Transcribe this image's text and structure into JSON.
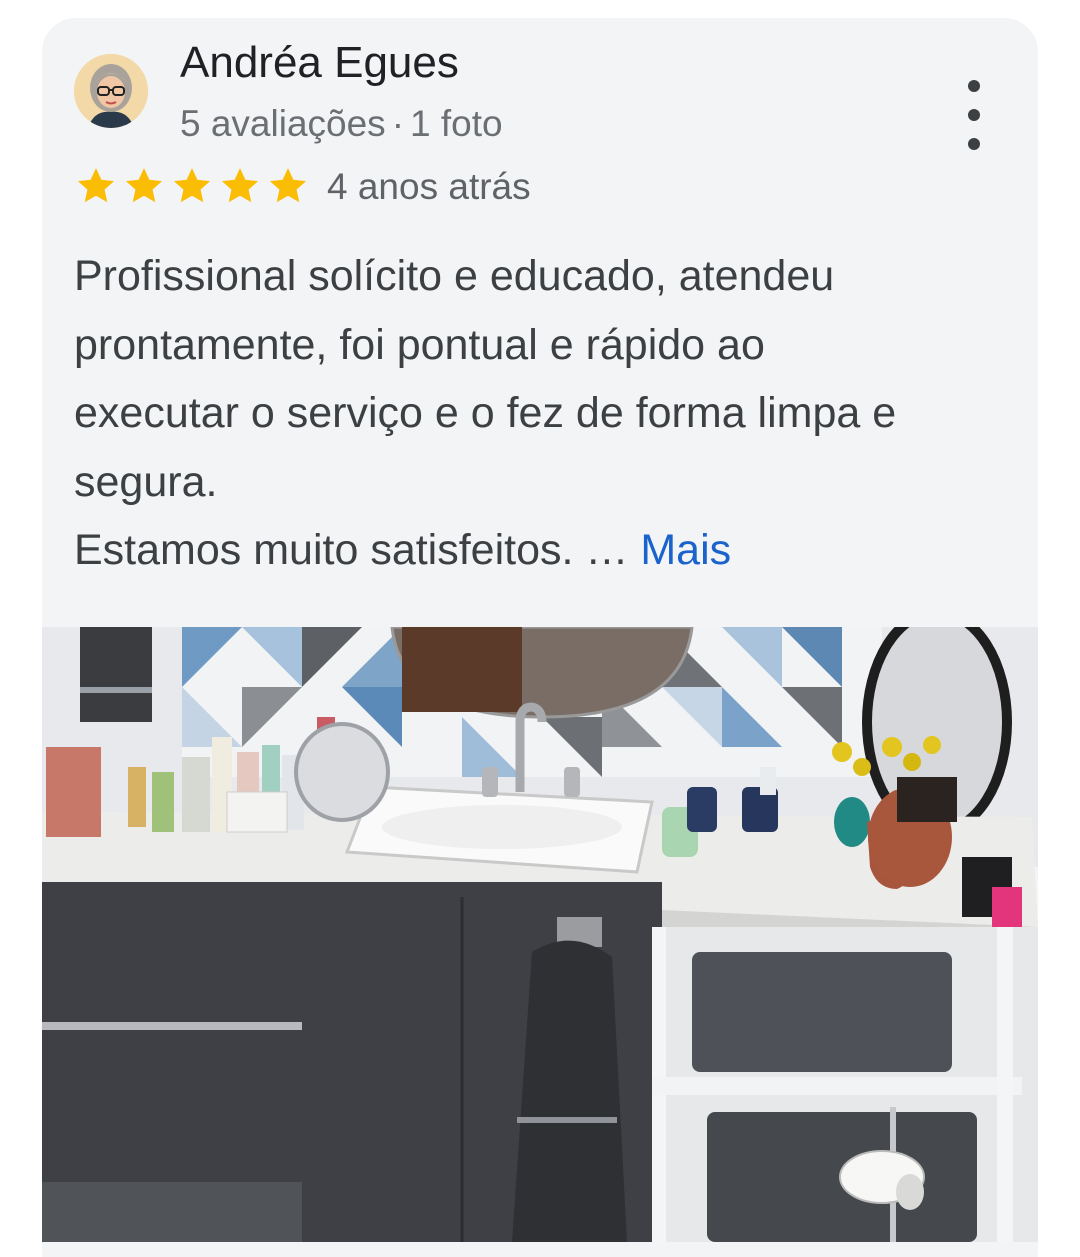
{
  "review": {
    "author": "Andréa Egues",
    "reviews_count": "5 avaliações",
    "separator": "·",
    "photos_count": "1 foto",
    "rating": 5,
    "rating_max": 5,
    "time_ago": "4 anos atrás",
    "text_lines": [
      "Profissional solícito e educado, atendeu",
      "prontamente, foi pontual e rápido ao",
      "executar o serviço e o fez de forma limpa e",
      "segura.",
      "Estamos muito satisfeitos. …"
    ],
    "more_label": "Mais"
  },
  "icons": {
    "menu": "more-vert-icon",
    "star": "star-icon"
  },
  "colors": {
    "card_background": "#f3f4f6",
    "star": "#fbbc04",
    "link": "#1a62cc",
    "text": "#3c4043",
    "secondary_text": "#6b6f73"
  }
}
